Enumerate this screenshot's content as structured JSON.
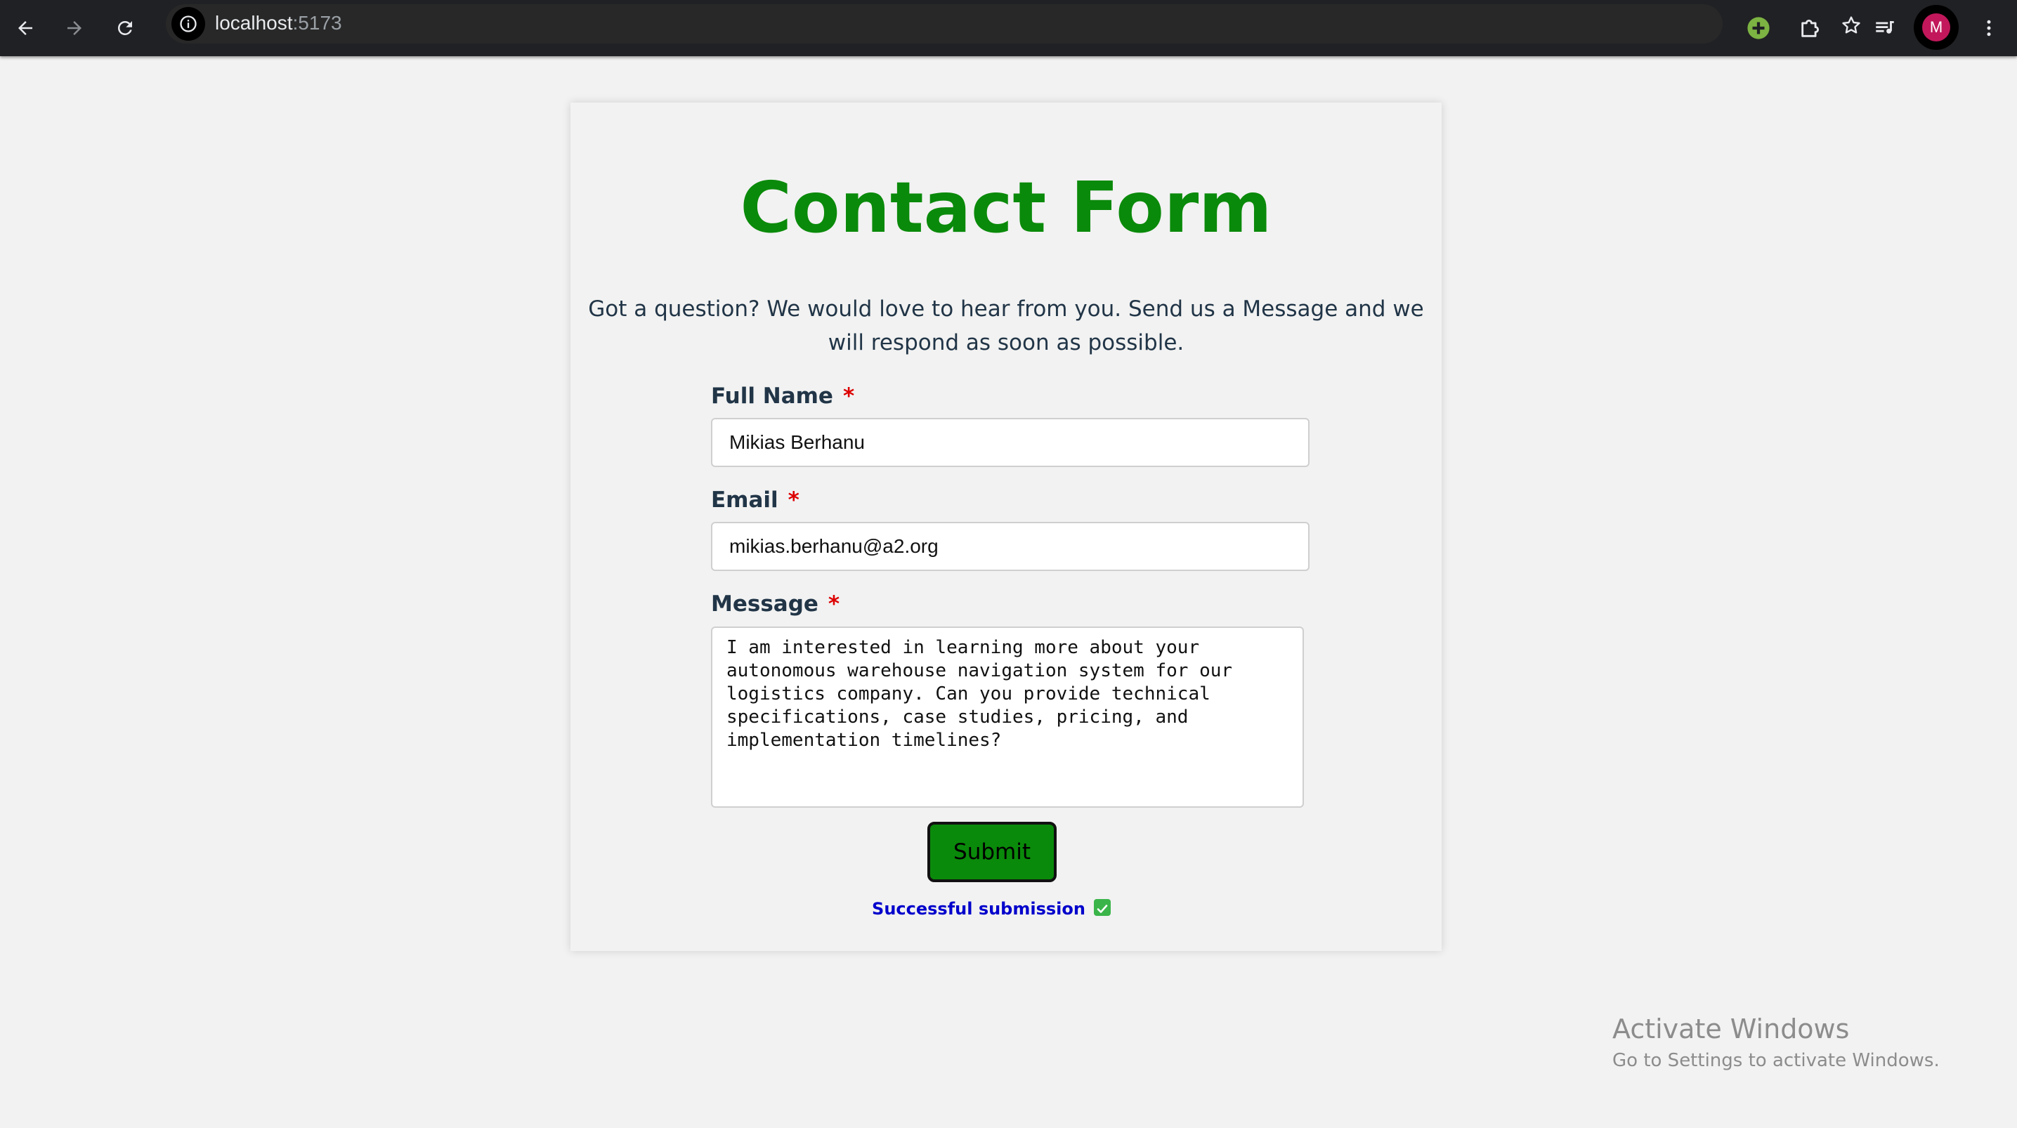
{
  "browser": {
    "url_host": "localhost",
    "url_port": ":5173",
    "avatar_initial": "M",
    "icons": {
      "back": "arrow-left-icon",
      "forward": "arrow-right-icon",
      "reload": "reload-icon",
      "site_info": "info-icon",
      "bookmark": "star-icon",
      "extension_green": "plus-circle-icon",
      "extensions": "puzzle-icon",
      "media": "queue-music-icon",
      "menu": "kebab-menu-icon"
    },
    "colors": {
      "chrome_bg": "#202124",
      "avatar_bg": "#c2185b",
      "extension_green": "#7cb342"
    }
  },
  "form": {
    "title": "Contact Form",
    "intro": "Got a question? We would love to hear from you. Send us a Message and we will respond as soon as possible.",
    "required_marker": "*",
    "full_name": {
      "label": "Full Name",
      "value": "Mikias Berhanu"
    },
    "email": {
      "label": "Email",
      "value": "mikias.berhanu@a2.org"
    },
    "message": {
      "label": "Message",
      "value": "I am interested in learning more about your\nautonomous warehouse navigation system for our\nlogistics company. Can you provide technical\nspecifications, case studies, pricing, and\nimplementation timelines?"
    },
    "submit_label": "Submit",
    "status_text": "Successful submission",
    "status_icon": "check-box-icon",
    "colors": {
      "title": "#0a8a0a",
      "button": "#0a8a0a",
      "required": "#dd0000",
      "status": "#0000cc",
      "text": "#213547"
    }
  },
  "watermark": {
    "line1": "Activate Windows",
    "line2": "Go to Settings to activate Windows."
  }
}
